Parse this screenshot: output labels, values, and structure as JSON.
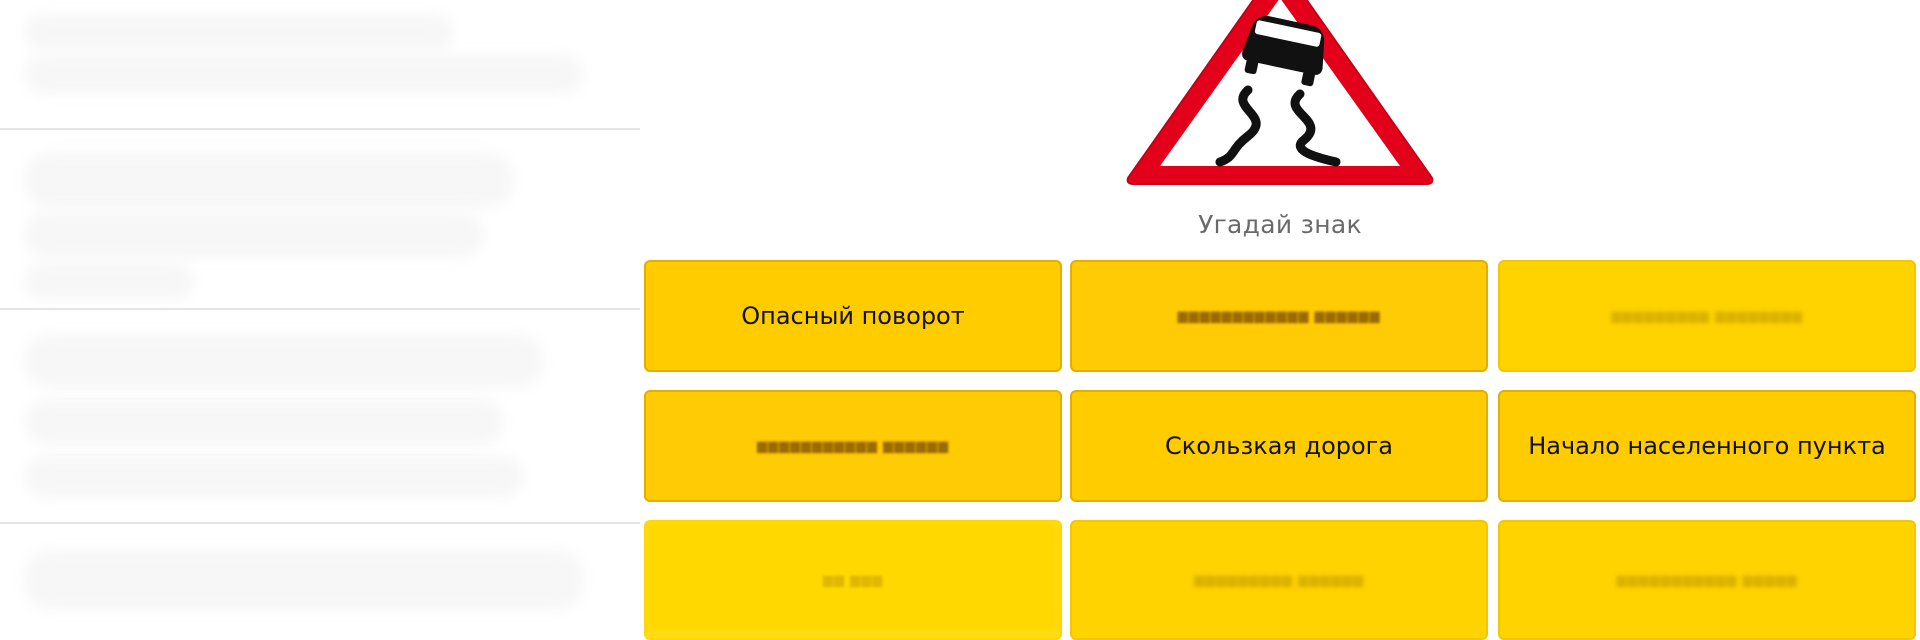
{
  "prompt": "Угадай знак",
  "sign": {
    "icon": "slippery-road-warning-icon",
    "colors": {
      "border": "#e3001b",
      "fill": "#ffffff",
      "symbol": "#111111"
    }
  },
  "colors": {
    "answer_bg": "#ffcc00",
    "answer_border": "#e0b000",
    "caption": "#6a6a6a"
  },
  "answers": [
    {
      "label": "Опасный поворот"
    },
    {
      "label": ""
    },
    {
      "label": ""
    },
    {
      "label": ""
    },
    {
      "label": "Скользкая дорога"
    },
    {
      "label": "Начало населенного пункта"
    },
    {
      "label": ""
    },
    {
      "label": ""
    },
    {
      "label": ""
    }
  ]
}
